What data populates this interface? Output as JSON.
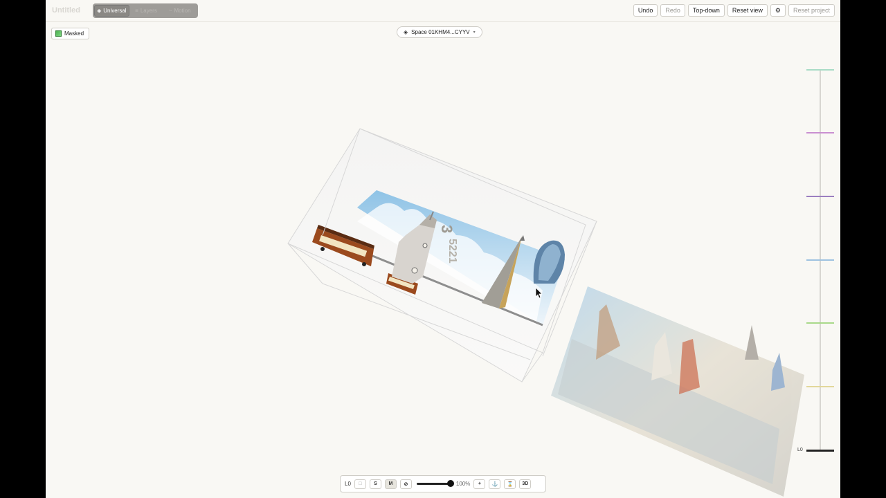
{
  "topbar": {
    "project_title": "Untitled",
    "modes": [
      {
        "label": "Universal",
        "icon": "cube-icon",
        "active": true
      },
      {
        "label": "Layers",
        "icon": "layers-icon",
        "active": false
      },
      {
        "label": "Motion",
        "icon": "motion-icon",
        "active": false
      }
    ],
    "undo_label": "Undo",
    "redo_label": "Redo",
    "topdown_label": "Top-down",
    "reset_view_label": "Reset view",
    "settings_icon": "gear-icon",
    "reset_project_label": "Reset project"
  },
  "masked": {
    "label": "Masked"
  },
  "space": {
    "label": "Space 01KHM4...CYYV"
  },
  "scene": {
    "box_number": "3",
    "box_label_digits": "5221"
  },
  "ruler": {
    "base_label": "L0",
    "tick_colors": [
      "#a8dcc6",
      "#c98fd1",
      "#9b7fc0",
      "#9ec2e0",
      "#a9d98a",
      "#e2d79a",
      "#222222"
    ]
  },
  "bottombar": {
    "layer_label": "L0",
    "box_icon": "square-icon",
    "s_label": "S",
    "m_label": "M",
    "slash_icon": "slash-icon",
    "zoom_pct": "100%",
    "plus_icon": "plus-icon",
    "anchor_icon": "anchor-icon",
    "hourglass_icon": "hourglass-icon",
    "threed_label": "3D"
  }
}
